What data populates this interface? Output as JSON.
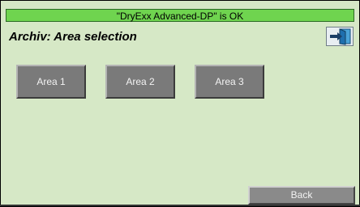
{
  "status": {
    "text": "\"DryExx Advanced-DP\" is OK"
  },
  "header": {
    "title": "Archiv: Area selection",
    "exit_icon": "exit-door-icon"
  },
  "areas": [
    {
      "label": "Area 1"
    },
    {
      "label": "Area 2"
    },
    {
      "label": "Area 3"
    }
  ],
  "footer": {
    "back_label": "Back"
  },
  "colors": {
    "background": "#d6e8c6",
    "status_ok": "#6fd44f",
    "button": "#7a7a7a"
  }
}
